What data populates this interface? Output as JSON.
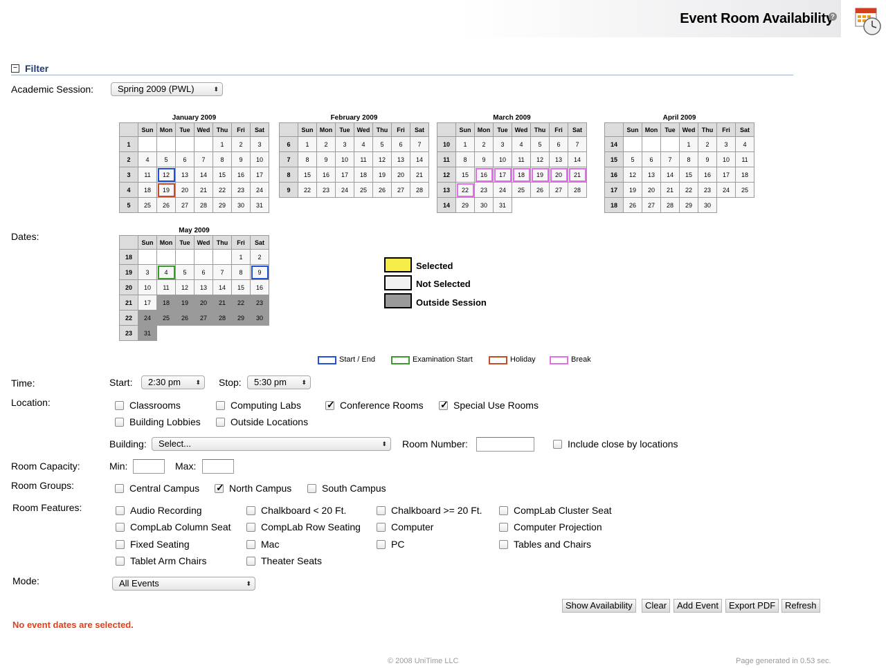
{
  "header": {
    "title": "Event Room Availability",
    "help_icon": "?"
  },
  "filter": {
    "toggle": "−",
    "label": "Filter"
  },
  "session": {
    "label": "Academic Session:",
    "value": "Spring 2009 (PWL)"
  },
  "dates_label": "Dates:",
  "months": [
    {
      "title": "January 2009",
      "days": [
        "Sun",
        "Mon",
        "Tue",
        "Wed",
        "Thu",
        "Fri",
        "Sat"
      ],
      "weeks": [
        {
          "wk": "1",
          "cells": [
            "",
            "",
            "",
            "",
            "1",
            "2",
            "3"
          ]
        },
        {
          "wk": "2",
          "cells": [
            "4",
            "5",
            "6",
            "7",
            "8",
            "9",
            "10"
          ]
        },
        {
          "wk": "3",
          "cells": [
            "11",
            "12",
            "13",
            "14",
            "15",
            "16",
            "17"
          ]
        },
        {
          "wk": "4",
          "cells": [
            "18",
            "19",
            "20",
            "21",
            "22",
            "23",
            "24"
          ]
        },
        {
          "wk": "5",
          "cells": [
            "25",
            "26",
            "27",
            "28",
            "29",
            "30",
            "31"
          ]
        }
      ]
    },
    {
      "title": "February 2009",
      "days": [
        "Sun",
        "Mon",
        "Tue",
        "Wed",
        "Thu",
        "Fri",
        "Sat"
      ],
      "weeks": [
        {
          "wk": "6",
          "cells": [
            "1",
            "2",
            "3",
            "4",
            "5",
            "6",
            "7"
          ]
        },
        {
          "wk": "7",
          "cells": [
            "8",
            "9",
            "10",
            "11",
            "12",
            "13",
            "14"
          ]
        },
        {
          "wk": "8",
          "cells": [
            "15",
            "16",
            "17",
            "18",
            "19",
            "20",
            "21"
          ]
        },
        {
          "wk": "9",
          "cells": [
            "22",
            "23",
            "24",
            "25",
            "26",
            "27",
            "28"
          ]
        }
      ]
    },
    {
      "title": "March 2009",
      "days": [
        "Sun",
        "Mon",
        "Tue",
        "Wed",
        "Thu",
        "Fri",
        "Sat"
      ],
      "weeks": [
        {
          "wk": "10",
          "cells": [
            "1",
            "2",
            "3",
            "4",
            "5",
            "6",
            "7"
          ]
        },
        {
          "wk": "11",
          "cells": [
            "8",
            "9",
            "10",
            "11",
            "12",
            "13",
            "14"
          ]
        },
        {
          "wk": "12",
          "cells": [
            "15",
            "16",
            "17",
            "18",
            "19",
            "20",
            "21"
          ]
        },
        {
          "wk": "13",
          "cells": [
            "22",
            "23",
            "24",
            "25",
            "26",
            "27",
            "28"
          ]
        },
        {
          "wk": "14",
          "cells": [
            "29",
            "30",
            "31",
            "",
            "",
            "",
            ""
          ]
        }
      ]
    },
    {
      "title": "April 2009",
      "days": [
        "Sun",
        "Mon",
        "Tue",
        "Wed",
        "Thu",
        "Fri",
        "Sat"
      ],
      "weeks": [
        {
          "wk": "14",
          "cells": [
            "",
            "",
            "",
            "1",
            "2",
            "3",
            "4"
          ]
        },
        {
          "wk": "15",
          "cells": [
            "5",
            "6",
            "7",
            "8",
            "9",
            "10",
            "11"
          ]
        },
        {
          "wk": "16",
          "cells": [
            "12",
            "13",
            "14",
            "15",
            "16",
            "17",
            "18"
          ]
        },
        {
          "wk": "17",
          "cells": [
            "19",
            "20",
            "21",
            "22",
            "23",
            "24",
            "25"
          ]
        },
        {
          "wk": "18",
          "cells": [
            "26",
            "27",
            "28",
            "29",
            "30",
            "",
            ""
          ]
        }
      ]
    },
    {
      "title": "May 2009",
      "days": [
        "Sun",
        "Mon",
        "Tue",
        "Wed",
        "Thu",
        "Fri",
        "Sat"
      ],
      "weeks": [
        {
          "wk": "18",
          "cells": [
            "",
            "",
            "",
            "",
            "",
            "1",
            "2"
          ]
        },
        {
          "wk": "19",
          "cells": [
            "3",
            "4",
            "5",
            "6",
            "7",
            "8",
            "9"
          ]
        },
        {
          "wk": "20",
          "cells": [
            "10",
            "11",
            "12",
            "13",
            "14",
            "15",
            "16"
          ]
        },
        {
          "wk": "21",
          "cells": [
            "17",
            "18",
            "19",
            "20",
            "21",
            "22",
            "23"
          ]
        },
        {
          "wk": "22",
          "cells": [
            "24",
            "25",
            "26",
            "27",
            "28",
            "29",
            "30"
          ]
        },
        {
          "wk": "23",
          "cells": [
            "31",
            "",
            "",
            "",
            "",
            "",
            ""
          ]
        }
      ]
    }
  ],
  "legend": {
    "selected": "Selected",
    "not_selected": "Not Selected",
    "outside": "Outside Session",
    "selected_color": "#f5ec4a",
    "not_selected_color": "#f0f0f0",
    "outside_color": "#9a9a9a"
  },
  "key": {
    "start_end": "Start / End",
    "exam": "Examination Start",
    "holiday": "Holiday",
    "break": "Break",
    "start_end_color": "#2050d8",
    "exam_color": "#3a9a2a",
    "holiday_color": "#c84a2a",
    "break_color": "#e070e8"
  },
  "time": {
    "label": "Time:",
    "start_label": "Start:",
    "start": "2:30 pm",
    "stop_label": "Stop:",
    "stop": "5:30 pm"
  },
  "location": {
    "label": "Location:",
    "options": [
      {
        "label": "Classrooms",
        "checked": false
      },
      {
        "label": "Computing Labs",
        "checked": false
      },
      {
        "label": "Conference Rooms",
        "checked": true
      },
      {
        "label": "Special Use Rooms",
        "checked": true
      },
      {
        "label": "Building Lobbies",
        "checked": false
      },
      {
        "label": "Outside Locations",
        "checked": false
      }
    ]
  },
  "building": {
    "label": "Building:",
    "value": "Select...",
    "room_label": "Room Number:",
    "close_by": "Include close by locations"
  },
  "capacity": {
    "label": "Room Capacity:",
    "min_label": "Min:",
    "max_label": "Max:"
  },
  "groups": {
    "label": "Room Groups:",
    "options": [
      {
        "label": "Central Campus",
        "checked": false
      },
      {
        "label": "North Campus",
        "checked": true
      },
      {
        "label": "South Campus",
        "checked": false
      }
    ]
  },
  "features": {
    "label": "Room Features:",
    "options": [
      {
        "label": "Audio Recording"
      },
      {
        "label": "Chalkboard < 20 Ft."
      },
      {
        "label": "Chalkboard >= 20 Ft."
      },
      {
        "label": "CompLab Cluster Seat"
      },
      {
        "label": "CompLab Column Seat"
      },
      {
        "label": "CompLab Row Seating"
      },
      {
        "label": "Computer"
      },
      {
        "label": "Computer Projection"
      },
      {
        "label": "Fixed Seating"
      },
      {
        "label": "Mac"
      },
      {
        "label": "PC"
      },
      {
        "label": "Tables and Chairs"
      },
      {
        "label": "Tablet Arm Chairs"
      },
      {
        "label": "Theater Seats"
      }
    ]
  },
  "mode": {
    "label": "Mode:",
    "value": "All Events"
  },
  "buttons": {
    "show": "Show Availability",
    "clear": "Clear",
    "add": "Add Event",
    "export": "Export PDF",
    "refresh": "Refresh"
  },
  "error": "No event dates are selected.",
  "footer": {
    "copyright": "© 2008 UniTime LLC",
    "generated": "Page generated in 0.53 sec."
  }
}
